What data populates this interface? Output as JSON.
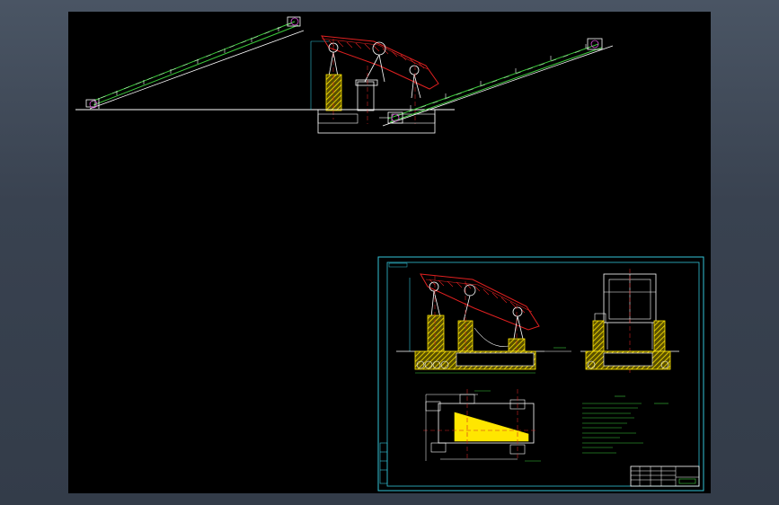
{
  "colors": {
    "background": "#000000",
    "frame_border": "#33c4d8",
    "conveyor_line": "#3dcc3d",
    "screen_body": "#e02020",
    "support_hatch": "#e8d400",
    "centerline": "#d02020",
    "structure_white": "#ffffff",
    "magenta": "#d64fd6",
    "annotation_green": "#44dd44",
    "app_chrome": "#3b4553"
  },
  "icons": {
    "title_block": "table-grid-icon",
    "hatch": "hatch-pattern-icon"
  },
  "drawing_sheet": {
    "title_label": "",
    "table_caption": ""
  }
}
